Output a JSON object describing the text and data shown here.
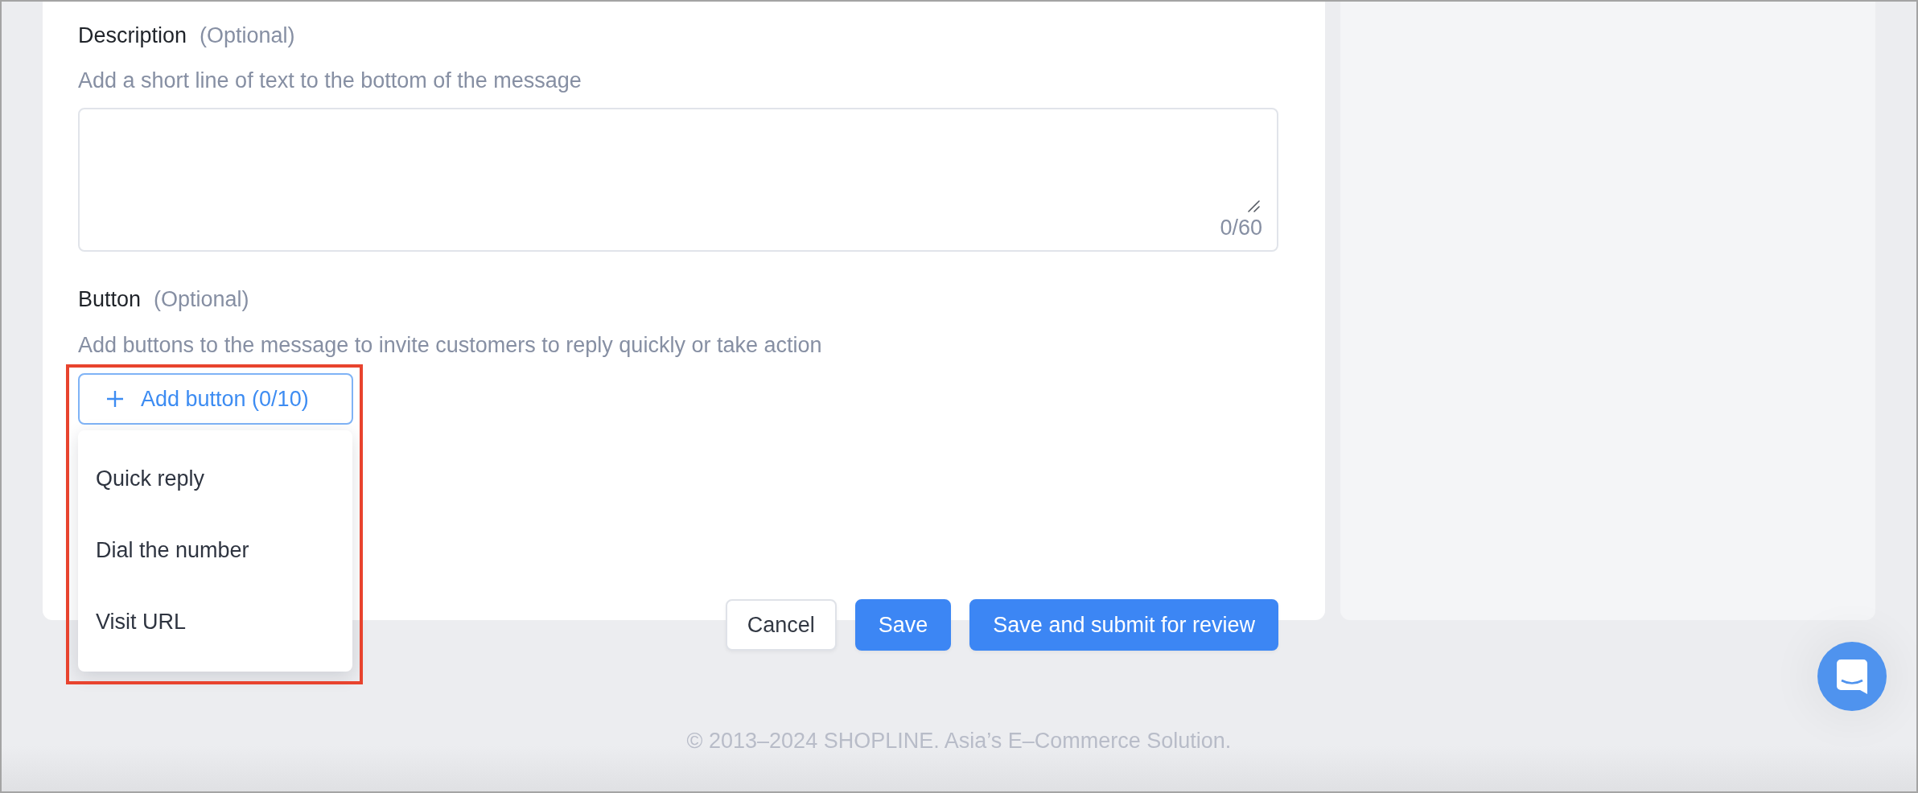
{
  "description": {
    "label": "Description",
    "optional_note": "(Optional)",
    "hint": "Add a short line of text to the bottom of the message",
    "counter": "0/60"
  },
  "button_section": {
    "label": "Button",
    "optional_note": "(Optional)",
    "hint": "Add buttons to the message to invite customers to reply quickly or take action",
    "add_button": {
      "label": "Add button (0/10)",
      "expanded": true,
      "highlighted": true
    },
    "menu_items": [
      {
        "label": "Quick reply"
      },
      {
        "label": "Dial the number"
      },
      {
        "label": "Visit URL"
      }
    ]
  },
  "actions": [
    {
      "label": "Cancel",
      "kind": "secondary"
    },
    {
      "label": "Save",
      "kind": "primary"
    },
    {
      "label": "Save and submit for review",
      "kind": "primary"
    }
  ],
  "footer": {
    "text": "© 2013–2024 SHOPLINE. Asia’s E–Commerce Solution."
  }
}
